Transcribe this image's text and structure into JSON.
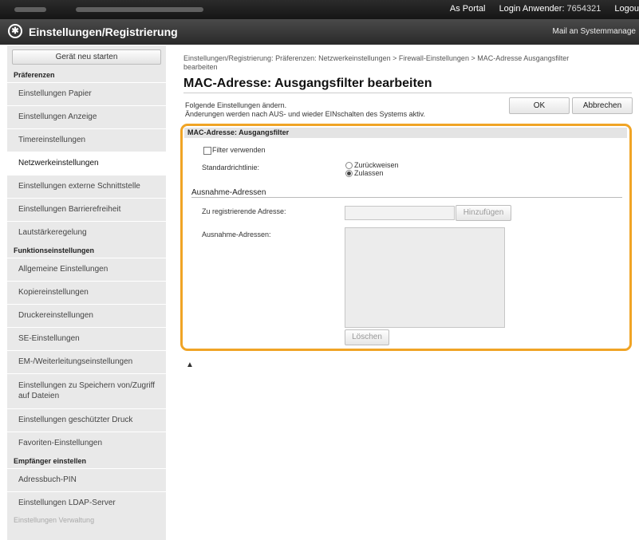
{
  "header": {
    "portal_link": "As Portal",
    "login_label": "Login Anwender:",
    "login_id": "7654321",
    "logout": "Logou",
    "app_title": "Einstellungen/Registrierung",
    "mail_link": "Mail an Systemmanage"
  },
  "sidebar": {
    "start_button": "Gerät neu starten",
    "sections": [
      {
        "title": "Präferenzen",
        "items": [
          {
            "label": "Einstellungen Papier"
          },
          {
            "label": "Einstellungen Anzeige"
          },
          {
            "label": "Timereinstellungen"
          },
          {
            "label": "Netzwerkeinstellungen"
          },
          {
            "label": "Einstellungen externe Schnittstelle"
          },
          {
            "label": "Einstellungen Barrierefreiheit"
          },
          {
            "label": "Lautstärkeregelung"
          }
        ]
      },
      {
        "title": "Funktionseinstellungen",
        "items": [
          {
            "label": "Allgemeine Einstellungen"
          },
          {
            "label": "Kopiereinstellungen"
          },
          {
            "label": "Druckereinstellungen"
          },
          {
            "label": "SE-Einstellungen"
          },
          {
            "label": "EM-/Weiterleitungseinstellungen"
          },
          {
            "label": "Einstellungen zu Speichern von/Zugriff auf Dateien"
          },
          {
            "label": "Einstellungen geschützter Druck"
          },
          {
            "label": "Favoriten-Einstellungen"
          }
        ]
      },
      {
        "title": "Empfänger einstellen",
        "items": [
          {
            "label": "Adressbuch-PIN"
          },
          {
            "label": "Einstellungen LDAP-Server"
          }
        ]
      }
    ],
    "footer_item": "Einstellungen Verwaltung"
  },
  "main": {
    "breadcrumb": "Einstellungen/Registrierung: Präferenzen: Netzwerkeinstellungen > Firewall-Einstellungen > MAC-Adresse Ausgangsfilter bearbeiten",
    "title": "MAC-Adresse: Ausgangsfilter bearbeiten",
    "info_line1": "Folgende Einstellungen ändern.",
    "info_line2": "Änderungen werden nach AUS- und wieder EINschalten des Systems aktiv.",
    "ok_button": "OK",
    "cancel_button": "Abbrechen",
    "panel": {
      "heading": "MAC-Adresse: Ausgangsfilter",
      "filter_checkbox_label": "Filter verwenden",
      "policy_label": "Standardrichtlinie:",
      "policy_options": [
        "Zurückweisen",
        "Zulassen"
      ],
      "policy_selected": "Zulassen",
      "exceptions_heading": "Ausnahme-Adressen",
      "register_label": "Zu registrierende Adresse:",
      "add_button": "Hinzufügen",
      "exceptions_label": "Ausnahme-Adressen:",
      "delete_button": "Löschen"
    },
    "top_link": "▲"
  },
  "colors": {
    "highlight": "#f0a425",
    "topbar": "#1f1f1f",
    "sidebar_bg": "#e9e9e9"
  }
}
